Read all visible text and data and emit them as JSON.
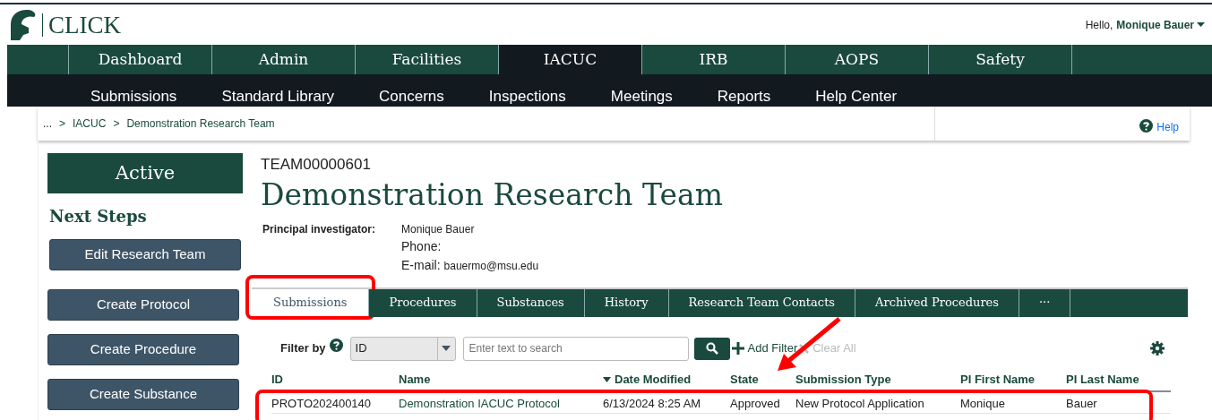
{
  "brand": {
    "name": "CLICK"
  },
  "user_menu": {
    "greeting": "Hello,",
    "name": "Monique Bauer"
  },
  "main_nav": [
    {
      "label": "Dashboard",
      "selected": false
    },
    {
      "label": "Admin",
      "selected": false
    },
    {
      "label": "Facilities",
      "selected": false
    },
    {
      "label": "IACUC",
      "selected": true
    },
    {
      "label": "IRB",
      "selected": false
    },
    {
      "label": "AOPS",
      "selected": false
    },
    {
      "label": "Safety",
      "selected": false
    }
  ],
  "sub_nav": [
    "Submissions",
    "Standard Library",
    "Concerns",
    "Inspections",
    "Meetings",
    "Reports",
    "Help Center"
  ],
  "breadcrumb": [
    "...",
    ">",
    "IACUC",
    ">",
    "Demonstration Research Team"
  ],
  "help": "Help",
  "status": "Active",
  "next_steps": {
    "title": "Next Steps",
    "buttons": [
      "Edit Research Team",
      "Create Protocol",
      "Create Procedure",
      "Create Substance"
    ]
  },
  "record": {
    "id": "TEAM00000601",
    "title": "Demonstration Research Team",
    "pi_label": "Principal investigator:",
    "pi_name": "Monique Bauer",
    "phone_label": "Phone:",
    "email_label": "E-mail:",
    "email": "bauermo@msu.edu"
  },
  "tabs": [
    {
      "label": "Submissions",
      "selected": true,
      "highlighted": true
    },
    {
      "label": "Procedures",
      "selected": false,
      "highlighted": false
    },
    {
      "label": "Substances",
      "selected": false,
      "highlighted": false
    },
    {
      "label": "History",
      "selected": false,
      "highlighted": false
    },
    {
      "label": "Research Team Contacts",
      "selected": false,
      "highlighted": false
    },
    {
      "label": "Archived Procedures",
      "selected": false,
      "highlighted": false
    },
    {
      "label": "···",
      "selected": false,
      "highlighted": false
    }
  ],
  "filter": {
    "label": "Filter by",
    "field": "ID",
    "placeholder": "Enter text to search",
    "add": "Add Filter",
    "clear": "Clear All"
  },
  "callouts": [
    {
      "kind": "arrow"
    }
  ],
  "table": {
    "columns": [
      {
        "label": "ID",
        "sorted": false
      },
      {
        "label": "Name",
        "sorted": false
      },
      {
        "label": "Date Modified",
        "sorted": true
      },
      {
        "label": "State",
        "sorted": false
      },
      {
        "label": "Submission Type",
        "sorted": false
      },
      {
        "label": "PI First Name",
        "sorted": false
      },
      {
        "label": "PI Last Name",
        "sorted": false
      }
    ],
    "rows": [
      {
        "highlighted": true,
        "cells": [
          "PROTO202400140",
          "Demonstration IACUC Protocol",
          "6/13/2024 8:25 AM",
          "Approved",
          "New Protocol Application",
          "Monique",
          "Bauer"
        ]
      }
    ]
  }
}
